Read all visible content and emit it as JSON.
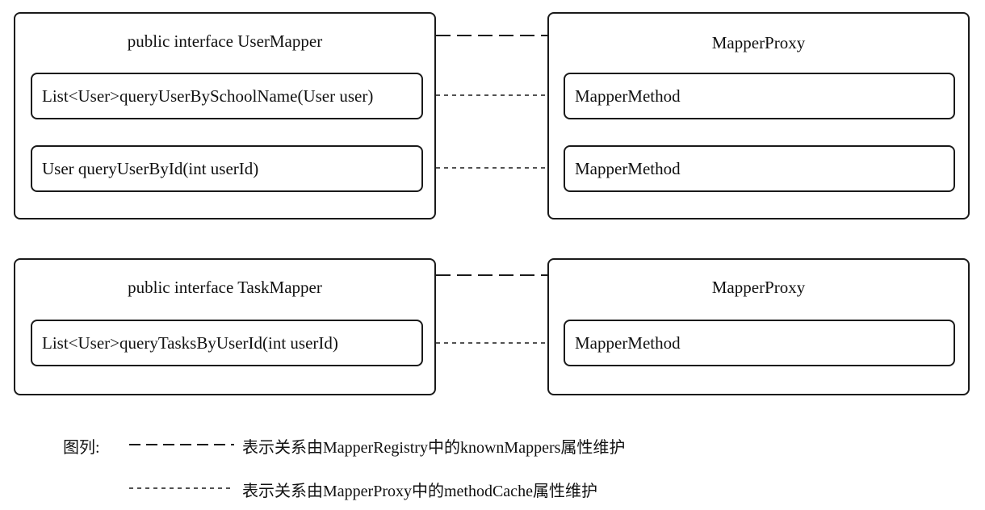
{
  "groups": [
    {
      "interface": {
        "title": "public interface UserMapper",
        "methods": [
          "List<User>queryUserBySchoolName(User user)",
          "User queryUserById(int userId)"
        ]
      },
      "proxy": {
        "title": "MapperProxy",
        "methods": [
          "MapperMethod",
          "MapperMethod"
        ]
      }
    },
    {
      "interface": {
        "title": "public interface TaskMapper",
        "methods": [
          "List<User>queryTasksByUserId(int userId)"
        ]
      },
      "proxy": {
        "title": "MapperProxy",
        "methods": [
          "MapperMethod"
        ]
      }
    }
  ],
  "legend": {
    "label": "图列:",
    "long_dash_text": "表示关系由MapperRegistry中的knownMappers属性维护",
    "short_dash_text": "表示关系由MapperProxy中的methodCache属性维护"
  }
}
